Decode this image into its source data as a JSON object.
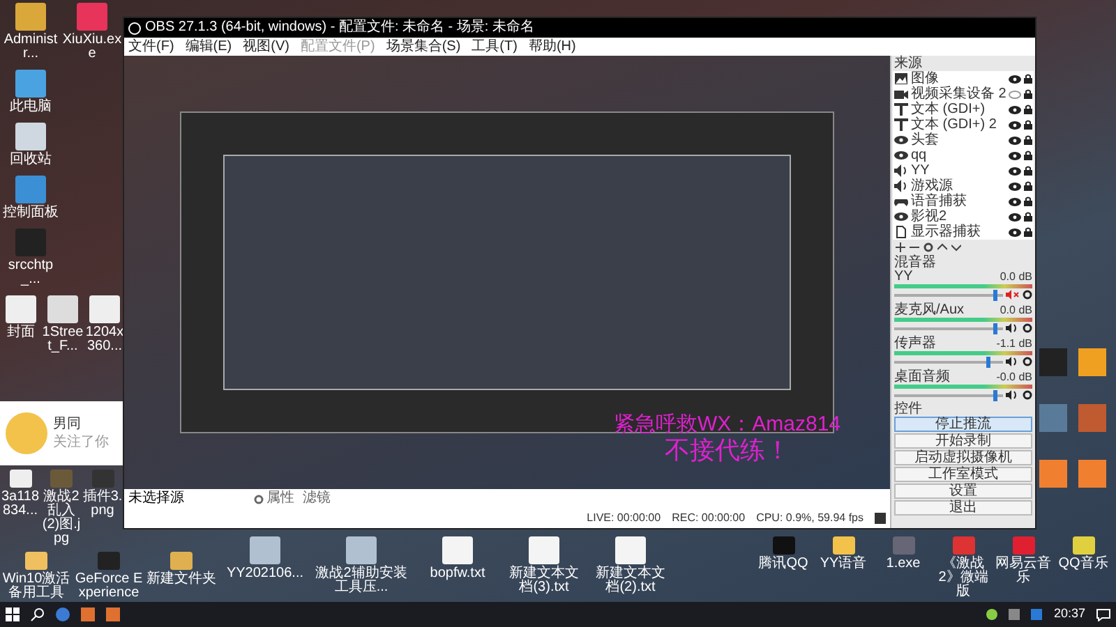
{
  "desktop": {
    "left_icons": [
      "Administr...",
      "XiuXiu.exe",
      "此电脑",
      "回收站",
      "控制面板",
      "srcchtp_...",
      "封面",
      "1Street_F...",
      "1204x360...",
      "3a118834...",
      "激战2乱入(2)图.jpg",
      "插件3.png",
      "Win10激活备用工具",
      "GeForce Experience",
      "新建文件夹"
    ],
    "bottom_icons": [
      "YY202106...",
      "激战2辅助安装工具压...",
      "bopfw.txt",
      "新建文本文档(3).txt",
      "新建文本文档(2).txt"
    ],
    "right_icons": [
      "腾讯QQ",
      "YY语音",
      "1.exe",
      "《激战2》微端版",
      "网易云音乐",
      "QQ音乐"
    ],
    "overlay": {
      "line_1": "紧急呼救WX：Amaz814",
      "line_2": "不接代练！"
    }
  },
  "notification": {
    "name": "男同",
    "message": "关注了你"
  },
  "window": {
    "title": "OBS 27.1.3 (64-bit, windows) - 配置文件: 未命名 - 场景: 未命名",
    "menu": [
      {
        "label": "文件(F)",
        "disabled": false
      },
      {
        "label": "编辑(E)",
        "disabled": false
      },
      {
        "label": "视图(V)",
        "disabled": false
      },
      {
        "label": "配置文件(P)",
        "disabled": true
      },
      {
        "label": "场景集合(S)",
        "disabled": false
      },
      {
        "label": "工具(T)",
        "disabled": false
      },
      {
        "label": "帮助(H)",
        "disabled": false
      }
    ]
  },
  "sources": {
    "title": "来源",
    "items": [
      {
        "kind": "image",
        "label": "图像",
        "visible": true
      },
      {
        "kind": "camera",
        "label": "视频采集设备 2",
        "visible": false
      },
      {
        "kind": "text",
        "label": "文本 (GDI+)",
        "visible": true
      },
      {
        "kind": "text",
        "label": "文本 (GDI+) 2",
        "visible": true
      },
      {
        "kind": "window",
        "label": "头套",
        "visible": true
      },
      {
        "kind": "window",
        "label": "qq",
        "visible": true
      },
      {
        "kind": "audio",
        "label": "YY",
        "visible": true
      },
      {
        "kind": "audio",
        "label": "游戏源",
        "visible": true
      },
      {
        "kind": "game",
        "label": "语音捕获",
        "visible": true
      },
      {
        "kind": "window",
        "label": "影视2",
        "visible": true
      },
      {
        "kind": "display",
        "label": "显示器捕获",
        "visible": true
      }
    ]
  },
  "mixer": {
    "title": "混音器",
    "channels": [
      {
        "name": "YY",
        "reading": "0.0 dB",
        "muted": true,
        "level": 0.95
      },
      {
        "name": "麦克风/Aux",
        "reading": "0.0 dB",
        "muted": false,
        "level": 0.95
      },
      {
        "name": "传声器",
        "reading": "-1.1 dB",
        "muted": false,
        "level": 0.88
      },
      {
        "name": "桌面音频",
        "reading": "-0.0 dB",
        "muted": false,
        "level": 0.95
      }
    ]
  },
  "controls": {
    "title": "控件",
    "buttons": [
      {
        "label": "停止推流",
        "selected": true
      },
      {
        "label": "开始录制",
        "selected": false
      },
      {
        "label": "启动虚拟摄像机",
        "selected": false
      },
      {
        "label": "工作室模式",
        "selected": false
      },
      {
        "label": "设置",
        "selected": false
      },
      {
        "label": "退出",
        "selected": false
      }
    ]
  },
  "source_bar": {
    "selection": "未选择源",
    "properties": "属性",
    "filters": "滤镜"
  },
  "status_bar": {
    "live": "LIVE: 00:00:00",
    "rec": "REC: 00:00:00",
    "cpu": "CPU: 0.9%, 59.94 fps"
  },
  "taskbar": {
    "time": "20:37"
  }
}
